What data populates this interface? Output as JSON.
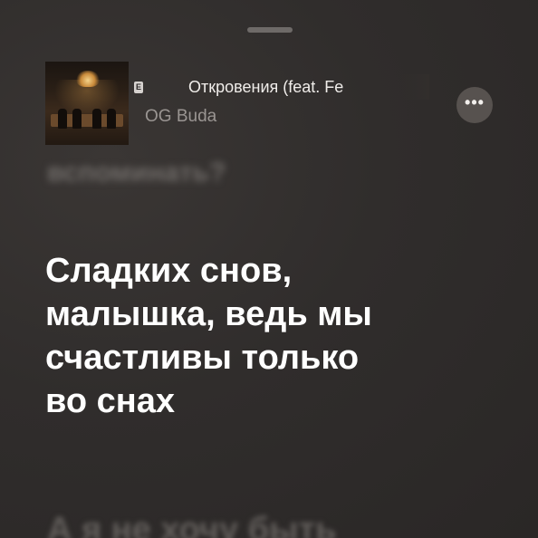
{
  "now_playing": {
    "title": "Откровения (feat. Fe",
    "artist": "OG Buda",
    "explicit_badge": "E",
    "more_icon": "ellipsis-icon",
    "more_label": "•••"
  },
  "lyrics": {
    "previous": "вспоминать?",
    "current_lines": [
      "Сладких снов,",
      "малышка, ведь мы",
      "счастливы только",
      "во снах"
    ],
    "next": "А я не хочу быть"
  },
  "colors": {
    "background": "#302d2c",
    "active_lyric": "#ffffff",
    "inactive_lyric": "#6f6b68",
    "artist_text": "#9a9592",
    "button_bg": "#57524f"
  }
}
